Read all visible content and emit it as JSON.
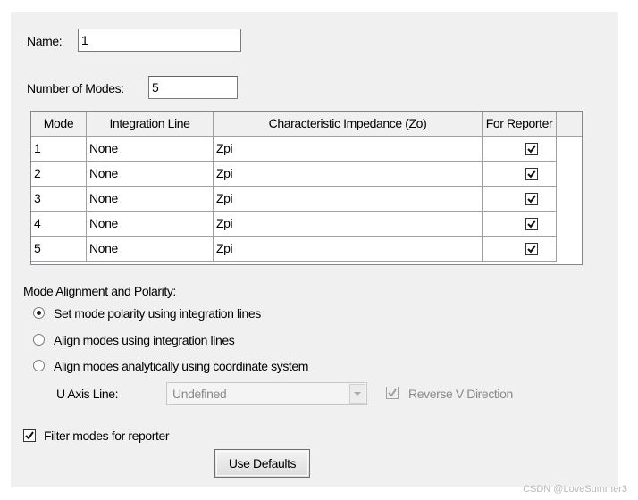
{
  "name_label": "Name:",
  "name_value": "1",
  "num_modes_label": "Number of Modes:",
  "num_modes_value": "5",
  "table": {
    "headers": [
      "Mode",
      "Integration Line",
      "Characteristic Impedance (Zo)",
      "For Reporter"
    ],
    "rows": [
      {
        "mode": "1",
        "integration_line": "None",
        "impedance": "Zpi",
        "for_reporter": true
      },
      {
        "mode": "2",
        "integration_line": "None",
        "impedance": "Zpi",
        "for_reporter": true
      },
      {
        "mode": "3",
        "integration_line": "None",
        "impedance": "Zpi",
        "for_reporter": true
      },
      {
        "mode": "4",
        "integration_line": "None",
        "impedance": "Zpi",
        "for_reporter": true
      },
      {
        "mode": "5",
        "integration_line": "None",
        "impedance": "Zpi",
        "for_reporter": true
      }
    ]
  },
  "alignment": {
    "group_label": "Mode Alignment and Polarity:",
    "options": [
      {
        "label": "Set mode polarity using integration lines",
        "selected": true
      },
      {
        "label": "Align modes using integration lines",
        "selected": false
      },
      {
        "label": "Align modes analytically using coordinate system",
        "selected": false
      }
    ],
    "u_axis_label": "U Axis Line:",
    "u_axis_value": "Undefined",
    "reverse_v_label": "Reverse V Direction",
    "reverse_v_checked": true
  },
  "filter_modes_label": "Filter modes for reporter",
  "filter_modes_checked": true,
  "use_defaults_label": "Use Defaults",
  "watermark": "CSDN @LoveSummer3"
}
